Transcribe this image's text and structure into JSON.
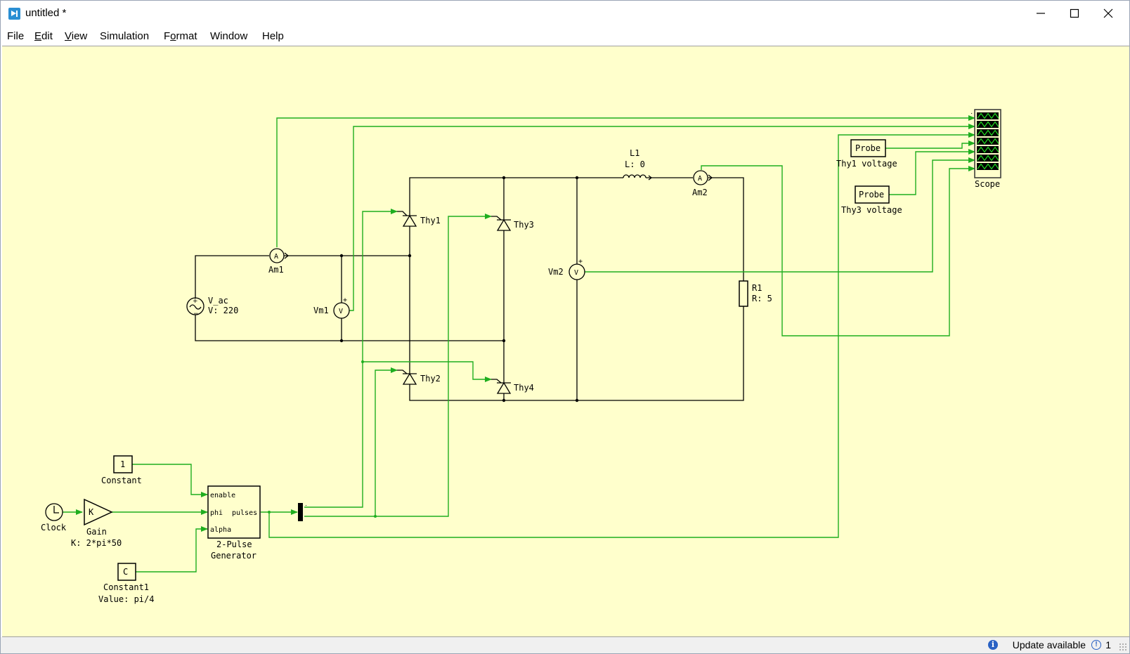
{
  "window": {
    "title": "untitled *",
    "controls": {
      "minimize": "minimize-icon",
      "maximize": "maximize-icon",
      "close": "close-icon"
    }
  },
  "menu": [
    {
      "label": "File",
      "mnemonic": ""
    },
    {
      "label": "Edit",
      "mnemonic": "E"
    },
    {
      "label": "View",
      "mnemonic": "V"
    },
    {
      "label": "Simulation",
      "mnemonic": ""
    },
    {
      "label": "Format",
      "mnemonic": "o"
    },
    {
      "label": "Window",
      "mnemonic": ""
    },
    {
      "label": "Help",
      "mnemonic": ""
    }
  ],
  "diagram": {
    "colors": {
      "canvas": "#ffffcc",
      "signal_wire": "#1fae1f",
      "power_wire": "#000000"
    },
    "components": {
      "v_ac": {
        "name": "V_ac",
        "param": "V: 220"
      },
      "am1": {
        "name": "Am1",
        "glyph": "A"
      },
      "vm1": {
        "name": "Vm1",
        "glyph": "V",
        "polarity": "+"
      },
      "thy1": {
        "name": "Thy1"
      },
      "thy2": {
        "name": "Thy2"
      },
      "thy3": {
        "name": "Thy3"
      },
      "thy4": {
        "name": "Thy4"
      },
      "l1": {
        "name": "L1",
        "param": "L: 0"
      },
      "am2": {
        "name": "Am2",
        "glyph": "A"
      },
      "vm2": {
        "name": "Vm2",
        "glyph": "V",
        "polarity": "+"
      },
      "r1": {
        "name": "R1",
        "param": "R: 5"
      },
      "probe1": {
        "text": "Probe",
        "name": "Thy1 voltage"
      },
      "probe3": {
        "text": "Probe",
        "name": "Thy3 voltage"
      },
      "scope": {
        "name": "Scope",
        "inputs": 7
      },
      "constant": {
        "value": "1",
        "name": "Constant"
      },
      "clock": {
        "name": "Clock"
      },
      "gain": {
        "glyph": "K",
        "name": "Gain",
        "param": "K: 2*pi*50"
      },
      "pulse_gen": {
        "name_line1": "2-Pulse",
        "name_line2": "Generator",
        "ports": {
          "enable": "enable",
          "phi": "phi",
          "alpha": "alpha",
          "out": "pulses"
        }
      },
      "constant1": {
        "value": "C",
        "name": "Constant1",
        "param": "Value: pi/4"
      }
    }
  },
  "status": {
    "message": "Update available",
    "warning_count": "1"
  }
}
